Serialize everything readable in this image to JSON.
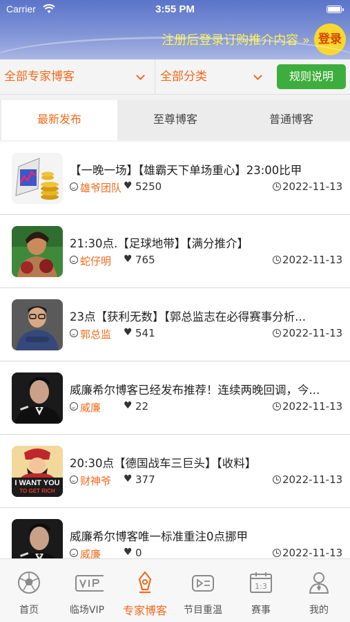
{
  "status_bar": {
    "carrier": "Carrier",
    "time": "3:55 PM"
  },
  "header": {
    "promo_text": "注册后登录订购推介内容 »",
    "login_label": "登录"
  },
  "filters": {
    "expert_filter": "全部专家博客",
    "category_filter": "全部分类",
    "rules_button": "规则说明"
  },
  "tabs": [
    {
      "label": "最新发布",
      "active": true
    },
    {
      "label": "至尊博客",
      "active": false
    },
    {
      "label": "普通博客",
      "active": false
    }
  ],
  "posts": [
    {
      "title": "【一晚一场】【雄霸天下单场重心】23:00比甲",
      "author": "雄爷团队",
      "likes": "5250",
      "date": "2022-11-13",
      "thumb": "chart-coins-icon"
    },
    {
      "title": "21:30点.【足球地带】【满分推介】",
      "author": "蛇仔明",
      "likes": "765",
      "date": "2022-11-13",
      "thumb": "boxer-avatar"
    },
    {
      "title": "23点【获利无数】【郭总监志在必得赛事分析...",
      "author": "郭总监",
      "likes": "541",
      "date": "2022-11-13",
      "thumb": "glasses-man-avatar"
    },
    {
      "title": "威廉希尔博客已经发布推荐！连续两晚回调，今...",
      "author": "威廉",
      "likes": "22",
      "date": "2022-11-13",
      "thumb": "suit-man-avatar"
    },
    {
      "title": "20:30点【德国战车三巨头】【收料】",
      "author": "财神爷",
      "likes": "377",
      "date": "2022-11-13",
      "thumb": "fortune-god-avatar",
      "thumb_text": [
        "I WANT YOU",
        "TO GET RICH"
      ]
    },
    {
      "title": "威廉希尔博客唯一标准重注0点挪甲",
      "author": "威廉",
      "likes": "0",
      "date": "2022-11-13",
      "thumb": "suit-man-avatar"
    }
  ],
  "bottom_nav": [
    {
      "label": "首页",
      "icon": "soccer-ball-icon",
      "active": false
    },
    {
      "label": "临场VIP",
      "icon": "vip-icon",
      "active": false
    },
    {
      "label": "专家博客",
      "icon": "expert-pen-icon",
      "active": true
    },
    {
      "label": "节目重温",
      "icon": "replay-tv-icon",
      "active": false
    },
    {
      "label": "赛事",
      "icon": "scoreboard-icon",
      "active": false
    },
    {
      "label": "我的",
      "icon": "profile-icon",
      "active": false
    }
  ],
  "colors": {
    "accent": "#f26a1b",
    "rules_green": "#3dae3d",
    "login_yellow": "#f7d830",
    "header_blue": "#6d83cf"
  }
}
